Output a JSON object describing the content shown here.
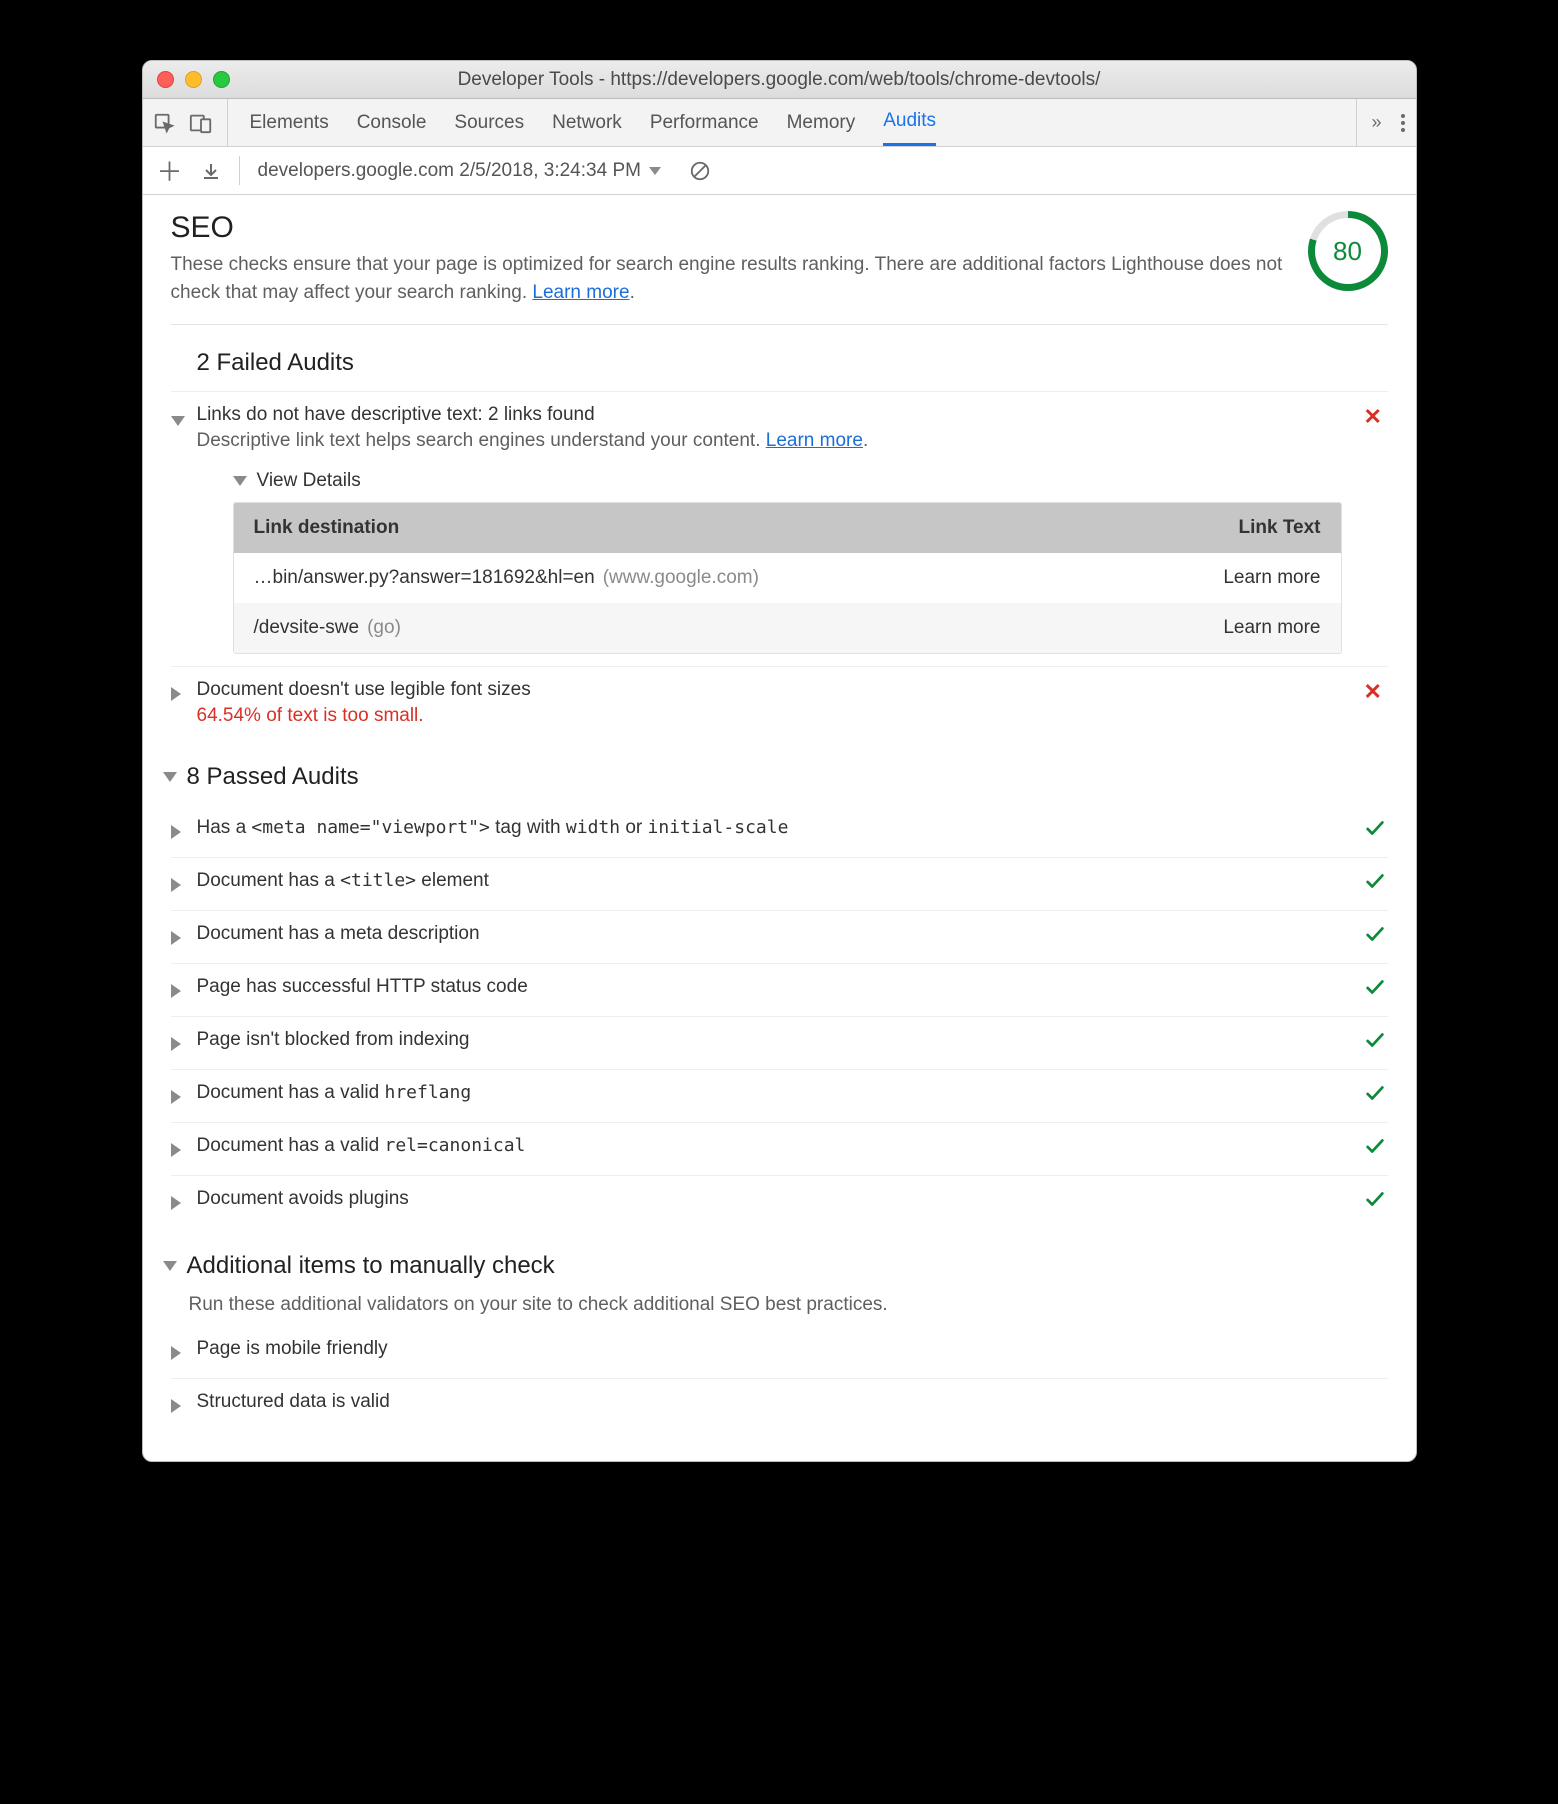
{
  "window": {
    "title": "Developer Tools - https://developers.google.com/web/tools/chrome-devtools/"
  },
  "toolbar": {
    "tabs": [
      "Elements",
      "Console",
      "Sources",
      "Network",
      "Performance",
      "Memory",
      "Audits"
    ],
    "active": "Audits"
  },
  "subbar": {
    "report": "developers.google.com 2/5/2018, 3:24:34 PM"
  },
  "seo": {
    "title": "SEO",
    "desc_prefix": "These checks ensure that your page is optimized for search engine results ranking. There are additional factors Lighthouse does not check that may affect your search ranking. ",
    "learn_more": "Learn more",
    "score": "80"
  },
  "failed": {
    "title": "2 Failed Audits",
    "items": [
      {
        "title": "Links do not have descriptive text: 2 links found",
        "sub_prefix": "Descriptive link text helps search engines understand your content. ",
        "learn_more": "Learn more",
        "details_label": "View Details",
        "table": {
          "col1": "Link destination",
          "col2": "Link Text",
          "rows": [
            {
              "dest": "…bin/answer.py?answer=181692&hl=en",
              "host": "(www.google.com)",
              "text": "Learn more"
            },
            {
              "dest": "/devsite-swe",
              "host": "(go)",
              "text": "Learn more"
            }
          ]
        }
      },
      {
        "title": "Document doesn't use legible font sizes",
        "warn": "64.54% of text is too small."
      }
    ]
  },
  "passed": {
    "title": "8 Passed Audits",
    "items": [
      {
        "pre": "Has a ",
        "code": "<meta name=\"viewport\">",
        "mid": " tag with ",
        "code2": "width",
        "mid2": " or ",
        "code3": "initial-scale"
      },
      {
        "pre": "Document has a ",
        "code": "<title>",
        "mid": " element"
      },
      {
        "pre": "Document has a meta description"
      },
      {
        "pre": "Page has successful HTTP status code"
      },
      {
        "pre": "Page isn't blocked from indexing"
      },
      {
        "pre": "Document has a valid ",
        "code": "hreflang"
      },
      {
        "pre": "Document has a valid ",
        "code": "rel=canonical"
      },
      {
        "pre": "Document avoids plugins"
      }
    ]
  },
  "manual": {
    "title": "Additional items to manually check",
    "desc": "Run these additional validators on your site to check additional SEO best practices.",
    "items": [
      "Page is mobile friendly",
      "Structured data is valid"
    ]
  }
}
